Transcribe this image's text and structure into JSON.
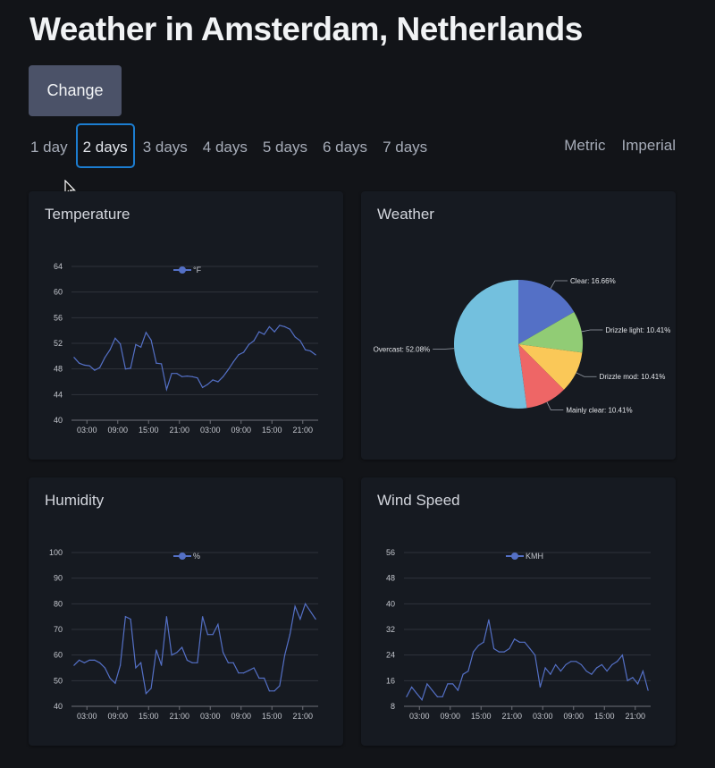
{
  "title": "Weather in Amsterdam, Netherlands",
  "change_button": "Change",
  "day_tabs": [
    "1 day",
    "2 days",
    "3 days",
    "4 days",
    "5 days",
    "6 days",
    "7 days"
  ],
  "active_day": "2 days",
  "unit_tabs": [
    "Metric",
    "Imperial"
  ],
  "charts": {
    "temperature": {
      "title": "Temperature"
    },
    "weather": {
      "title": "Weather"
    },
    "humidity": {
      "title": "Humidity"
    },
    "wind": {
      "title": "Wind Speed"
    }
  },
  "colors": {
    "series": "#5470c6",
    "grid": "#2f333b",
    "text": "#c4c7ce"
  },
  "chart_data": [
    {
      "id": "temperature",
      "type": "line",
      "title": "Temperature",
      "ylim": [
        40,
        64
      ],
      "yticks": [
        40,
        44,
        48,
        52,
        56,
        60,
        64
      ],
      "xticks": [
        "03:00",
        "09:00",
        "15:00",
        "21:00",
        "03:00",
        "09:00",
        "15:00",
        "21:00"
      ],
      "series": [
        {
          "name": "°F",
          "values": [
            49.8,
            48.9,
            48.6,
            48.5,
            47.8,
            48.2,
            49.8,
            51.0,
            52.8,
            51.9,
            48.0,
            48.1,
            51.8,
            51.4,
            53.7,
            52.5,
            48.9,
            48.8,
            44.8,
            47.3,
            47.3,
            46.8,
            46.9,
            46.8,
            46.6,
            45.1,
            45.6,
            46.3,
            46.0,
            46.8,
            47.9,
            49.1,
            50.2,
            50.6,
            51.8,
            52.4,
            53.8,
            53.4,
            54.6,
            53.8,
            54.8,
            54.6,
            54.2,
            53.0,
            52.4,
            51.0,
            50.8,
            50.2
          ]
        }
      ]
    },
    {
      "id": "weather",
      "type": "pie",
      "title": "Weather",
      "series": [
        {
          "values": [
            {
              "label": "Clear: 16.66%",
              "value": 16.66,
              "color": "#5470c6"
            },
            {
              "label": "Drizzle light: 10.41%",
              "value": 10.41,
              "color": "#91cc75"
            },
            {
              "label": "Drizzle mod: 10.41%",
              "value": 10.41,
              "color": "#fac858"
            },
            {
              "label": "Mainly clear: 10.41%",
              "value": 10.41,
              "color": "#ee6666"
            },
            {
              "label": "Overcast: 52.08%",
              "value": 52.08,
              "color": "#73c0de"
            }
          ]
        }
      ]
    },
    {
      "id": "humidity",
      "type": "line",
      "title": "Humidity",
      "ylim": [
        40,
        100
      ],
      "yticks": [
        40,
        50,
        60,
        70,
        80,
        90,
        100
      ],
      "xticks": [
        "03:00",
        "09:00",
        "15:00",
        "21:00",
        "03:00",
        "09:00",
        "15:00",
        "21:00"
      ],
      "series": [
        {
          "name": "%",
          "values": [
            56,
            58,
            57,
            58,
            58,
            57,
            55,
            51,
            49,
            56,
            75,
            74,
            55,
            57,
            45,
            47,
            62,
            56,
            75,
            60,
            61,
            63,
            58,
            57,
            57,
            75,
            68,
            68,
            72,
            61,
            57,
            57,
            53,
            53,
            54,
            55,
            51,
            51,
            46,
            46,
            48,
            60,
            68,
            79,
            74,
            80,
            77,
            74
          ]
        }
      ]
    },
    {
      "id": "wind",
      "type": "line",
      "title": "Wind Speed",
      "ylim": [
        8,
        56
      ],
      "yticks": [
        8,
        16,
        24,
        32,
        40,
        48,
        56
      ],
      "xticks": [
        "03:00",
        "09:00",
        "15:00",
        "21:00",
        "03:00",
        "09:00",
        "15:00",
        "21:00"
      ],
      "series": [
        {
          "name": "KMH",
          "values": [
            11,
            14,
            12,
            10,
            15,
            13,
            11,
            11,
            15,
            15,
            13,
            18,
            19,
            25,
            27,
            28,
            35,
            26,
            25,
            25,
            26,
            29,
            28,
            28,
            26,
            24,
            14,
            20,
            18,
            21,
            19,
            21,
            22,
            22,
            21,
            19,
            18,
            20,
            21,
            19,
            21,
            22,
            24,
            16,
            17,
            15,
            19,
            13
          ]
        }
      ]
    }
  ]
}
